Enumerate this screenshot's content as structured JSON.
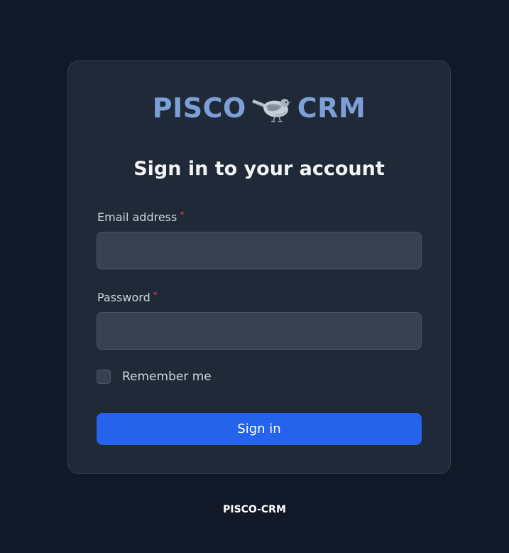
{
  "logo": {
    "left_text": "PISCO",
    "right_text": "CRM",
    "icon": "bird-icon"
  },
  "heading": "Sign in to your account",
  "form": {
    "email": {
      "label": "Email address",
      "required_marker": "*",
      "value": ""
    },
    "password": {
      "label": "Password",
      "required_marker": "*",
      "value": ""
    },
    "remember_label": "Remember me",
    "submit_label": "Sign in"
  },
  "footer": "PISCO-CRM",
  "colors": {
    "background": "#111827",
    "card": "#1f2937",
    "accent": "#2563eb",
    "logo": "#7b9fd6",
    "required": "#ef4444"
  }
}
